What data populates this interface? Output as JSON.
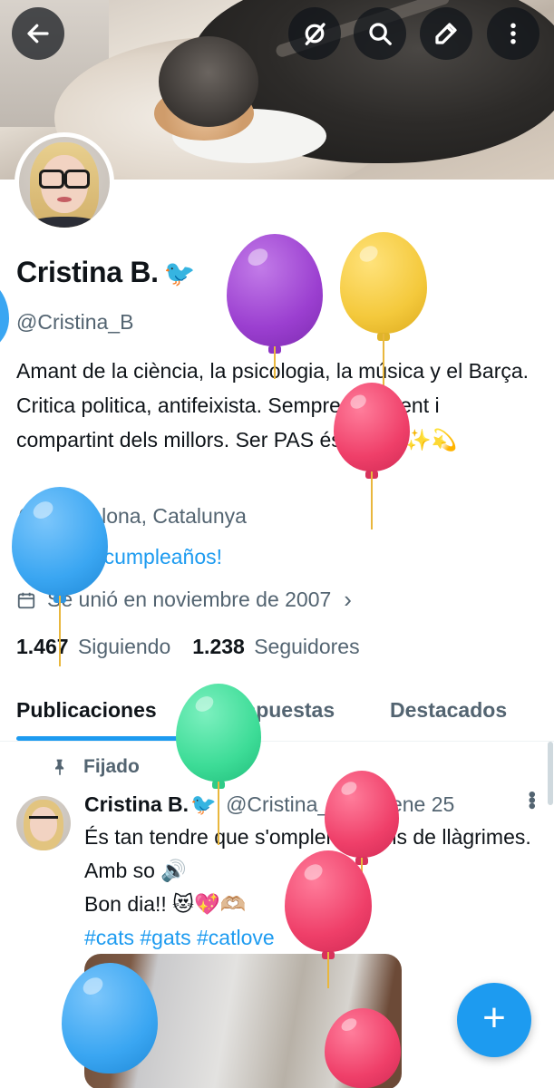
{
  "header": {
    "back_icon": "arrow-left-icon",
    "actions": [
      "grok-icon",
      "search-icon",
      "edit-icon",
      "more-vertical-icon"
    ]
  },
  "profile": {
    "name": "Cristina B.",
    "verified_emoji": "🐦",
    "handle": "@Cristina_B",
    "bio": "Amant de la ciència, la psicologia, la música y el Barça. Critica politica, antifeixista. Sempre aprenent i compartint dels millors. Ser PAS és un do ✨💫",
    "location": "Barcelona, Catalunya",
    "birthday": "¡Feliz cumpleaños!",
    "joined": "Se unió en noviembre de 2007",
    "following_count": "1.467",
    "following_label": "Siguiendo",
    "followers_count": "1.238",
    "followers_label": "Seguidores"
  },
  "tabs": [
    {
      "label": "Publicaciones",
      "active": true
    },
    {
      "label": "Respuestas",
      "active": false
    },
    {
      "label": "Destacados",
      "active": false
    }
  ],
  "post": {
    "pinned_label": "Fijado",
    "author": "Cristina B.",
    "author_emoji": "🐦",
    "handle": "@Cristina_B",
    "separator": "·",
    "date": "27 ene 25",
    "text_line1": "És tan tendre que s'omplen els ulls de llàgrimes. Amb so 🔊",
    "text_line2": "Bon dia!! 😻💖🫶🏼",
    "hashtags": "#cats #gats #catlove"
  },
  "fab": {
    "label": "+"
  },
  "colors": {
    "accent": "#1d9bf0",
    "text": "#0f1419",
    "muted": "#536471",
    "balloon_purple": "#a54ad6",
    "balloon_yellow": "#f4c93c",
    "balloon_red": "#ef3f69",
    "balloon_blue": "#3aa6f2",
    "balloon_green": "#3ddc97"
  }
}
